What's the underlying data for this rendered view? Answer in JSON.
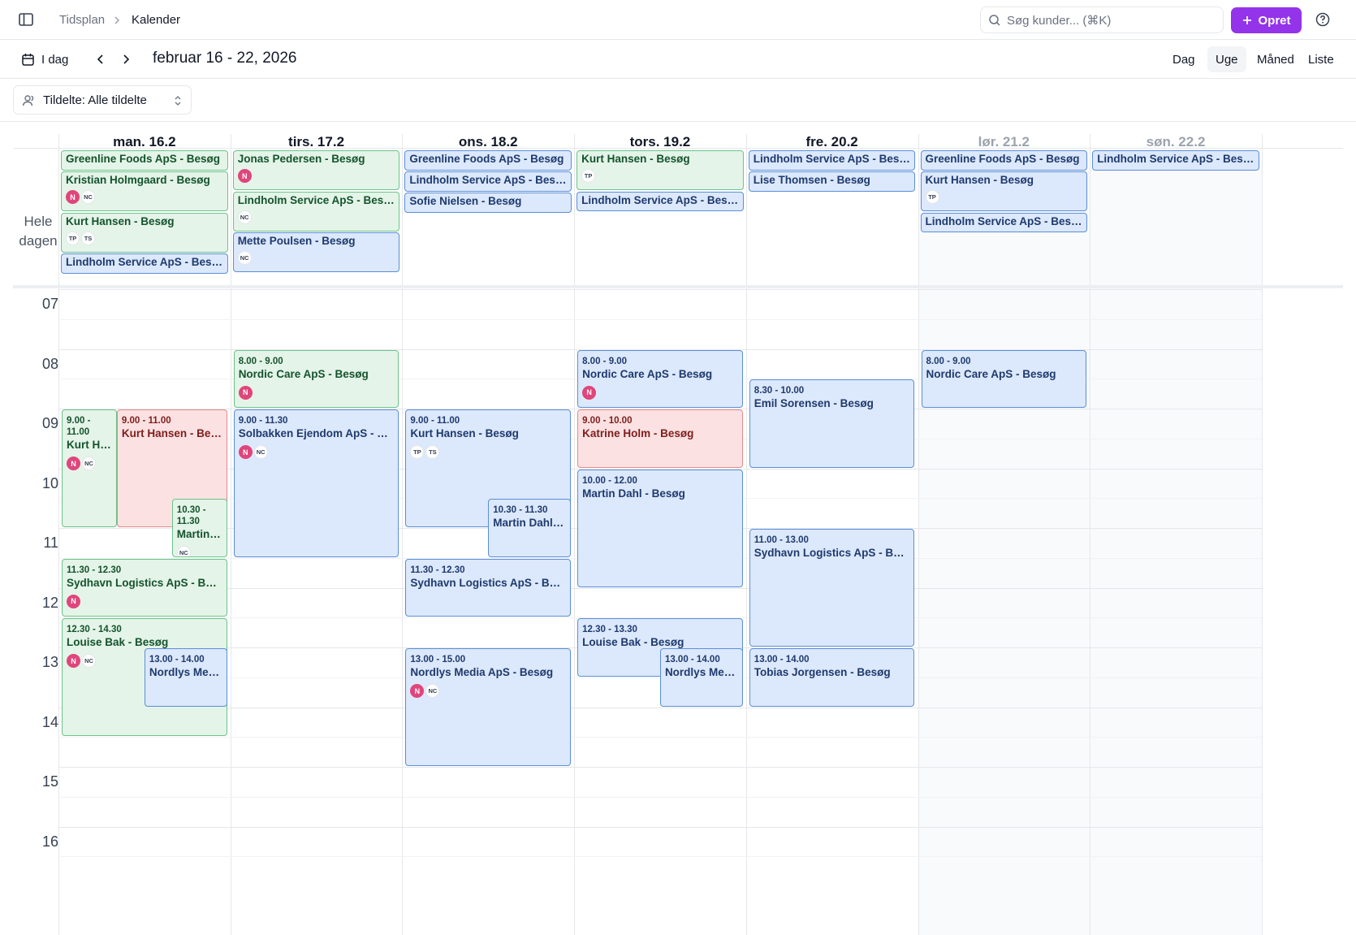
{
  "header": {
    "breadcrumb": [
      "Tidsplan",
      "Kalender"
    ],
    "search_placeholder": "Søg kunder... (⌘K)",
    "create_label": "Opret"
  },
  "toolbar": {
    "today_label": "I dag",
    "range_title": "februar 16 - 22, 2026",
    "views": [
      "Dag",
      "Uge",
      "Måned",
      "Liste"
    ],
    "active_view": "Uge"
  },
  "filter": {
    "assignee_label": "Tildelte: Alle tildelte"
  },
  "calendar": {
    "allday_label": [
      "Hele",
      "dagen"
    ],
    "hours": [
      "07",
      "08",
      "09",
      "10",
      "11",
      "12",
      "13",
      "14",
      "15",
      "16"
    ],
    "days": [
      {
        "label": "man. 16.2",
        "weekend": false
      },
      {
        "label": "tirs. 17.2",
        "weekend": false
      },
      {
        "label": "ons. 18.2",
        "weekend": false
      },
      {
        "label": "tors. 19.2",
        "weekend": false
      },
      {
        "label": "fre. 20.2",
        "weekend": false
      },
      {
        "label": "lør. 21.2",
        "weekend": true
      },
      {
        "label": "søn. 22.2",
        "weekend": true
      }
    ],
    "colors": {
      "green": "#e4f4e8",
      "blue": "#dce8fb",
      "red": "#fbe1e1",
      "accent": "#9333ea",
      "avatar": "#e0457b"
    },
    "allday_events": [
      {
        "day": 0,
        "title": "Greenline Foods ApS - Besøg",
        "color": "green",
        "avatars": []
      },
      {
        "day": 0,
        "title": "Kristian Holmgaard - Besøg",
        "color": "green",
        "avatars": [
          "N",
          "NC"
        ]
      },
      {
        "day": 0,
        "title": "Kurt Hansen - Besøg",
        "color": "green",
        "avatars": [
          "TP",
          "TS"
        ]
      },
      {
        "day": 0,
        "title": "Lindholm Service ApS - Besøg",
        "color": "blue",
        "avatars": []
      },
      {
        "day": 1,
        "title": "Jonas Pedersen - Besøg",
        "color": "green",
        "avatars": [
          "N"
        ]
      },
      {
        "day": 1,
        "title": "Lindholm Service ApS - Besøg",
        "color": "green",
        "avatars": [
          "NC"
        ]
      },
      {
        "day": 1,
        "title": "Mette Poulsen - Besøg",
        "color": "blue",
        "avatars": [
          "NC"
        ]
      },
      {
        "day": 2,
        "title": "Greenline Foods ApS - Besøg",
        "color": "blue",
        "avatars": []
      },
      {
        "day": 2,
        "title": "Lindholm Service ApS - Besøg",
        "color": "blue",
        "avatars": []
      },
      {
        "day": 2,
        "title": "Sofie Nielsen - Besøg",
        "color": "blue",
        "avatars": []
      },
      {
        "day": 3,
        "title": "Kurt Hansen - Besøg",
        "color": "green",
        "avatars": [
          "TP"
        ]
      },
      {
        "day": 3,
        "title": "Lindholm Service ApS - Besøg",
        "color": "blue",
        "avatars": []
      },
      {
        "day": 4,
        "title": "Lindholm Service ApS - Besøg",
        "color": "blue",
        "avatars": []
      },
      {
        "day": 4,
        "title": "Lise Thomsen - Besøg",
        "color": "blue",
        "avatars": []
      },
      {
        "day": 5,
        "title": "Greenline Foods ApS - Besøg",
        "color": "blue",
        "avatars": []
      },
      {
        "day": 5,
        "title": "Kurt Hansen - Besøg",
        "color": "blue",
        "avatars": [
          "TP"
        ]
      },
      {
        "day": 5,
        "title": "Lindholm Service ApS - Besøg",
        "color": "blue",
        "avatars": []
      },
      {
        "day": 6,
        "title": "Lindholm Service ApS - Besøg",
        "color": "blue",
        "avatars": []
      }
    ],
    "timed_events": [
      {
        "day": 0,
        "start": 9.0,
        "end": 11.0,
        "time": "9.00 - 11.00",
        "title": "Kurt Hansen - Besøg",
        "color": "green",
        "avatars": [
          "N",
          "NC"
        ],
        "col": 0,
        "cols": 3
      },
      {
        "day": 0,
        "start": 9.0,
        "end": 11.0,
        "time": "9.00 - 11.00",
        "title": "Kurt Hansen - Besøg",
        "color": "red",
        "avatars": [],
        "col": 1,
        "cols": 3,
        "span": 2
      },
      {
        "day": 0,
        "start": 10.5,
        "end": 11.5,
        "time": "10.30 - 11.30",
        "title": "Martin Dahl - Besøg",
        "color": "green",
        "avatars": [
          "NC"
        ],
        "col": 2,
        "cols": 3
      },
      {
        "day": 0,
        "start": 11.5,
        "end": 12.5,
        "time": "11.30 - 12.30",
        "title": "Sydhavn Logistics ApS - Besøg",
        "color": "green",
        "avatars": [
          "N"
        ],
        "col": 0,
        "cols": 1
      },
      {
        "day": 0,
        "start": 12.5,
        "end": 14.5,
        "time": "12.30 - 14.30",
        "title": "Louise Bak - Besøg",
        "color": "green",
        "avatars": [
          "N",
          "NC"
        ],
        "col": 0,
        "cols": 1
      },
      {
        "day": 0,
        "start": 13.0,
        "end": 14.0,
        "time": "13.00 - 14.00",
        "title": "Nordlys Media ApS - Besøg",
        "color": "blue",
        "avatars": [],
        "col": 1,
        "cols": 2
      },
      {
        "day": 1,
        "start": 8.0,
        "end": 9.0,
        "time": "8.00 - 9.00",
        "title": "Nordic Care ApS - Besøg",
        "color": "green",
        "avatars": [
          "N"
        ],
        "col": 0,
        "cols": 1
      },
      {
        "day": 1,
        "start": 9.0,
        "end": 11.5,
        "time": "9.00 - 11.30",
        "title": "Solbakken Ejendom ApS - Besøg",
        "color": "blue",
        "avatars": [
          "N",
          "NC"
        ],
        "col": 0,
        "cols": 1
      },
      {
        "day": 2,
        "start": 9.0,
        "end": 11.0,
        "time": "9.00 - 11.00",
        "title": "Kurt Hansen - Besøg",
        "color": "blue",
        "avatars": [
          "TP",
          "TS"
        ],
        "col": 0,
        "cols": 1
      },
      {
        "day": 2,
        "start": 10.5,
        "end": 11.5,
        "time": "10.30 - 11.30",
        "title": "Martin Dahl - Besøg",
        "color": "blue",
        "avatars": [],
        "col": 1,
        "cols": 2
      },
      {
        "day": 2,
        "start": 11.5,
        "end": 12.5,
        "time": "11.30 - 12.30",
        "title": "Sydhavn Logistics ApS - Besøg",
        "color": "blue",
        "avatars": [],
        "col": 0,
        "cols": 1
      },
      {
        "day": 2,
        "start": 13.0,
        "end": 15.0,
        "time": "13.00 - 15.00",
        "title": "Nordlys Media ApS - Besøg",
        "color": "blue",
        "avatars": [
          "N",
          "NC"
        ],
        "col": 0,
        "cols": 1
      },
      {
        "day": 3,
        "start": 8.0,
        "end": 9.0,
        "time": "8.00 - 9.00",
        "title": "Nordic Care ApS - Besøg",
        "color": "blue",
        "avatars": [
          "N"
        ],
        "col": 0,
        "cols": 1
      },
      {
        "day": 3,
        "start": 9.0,
        "end": 10.0,
        "time": "9.00 - 10.00",
        "title": "Katrine Holm - Besøg",
        "color": "red",
        "avatars": [],
        "col": 0,
        "cols": 1
      },
      {
        "day": 3,
        "start": 10.0,
        "end": 12.0,
        "time": "10.00 - 12.00",
        "title": "Martin Dahl - Besøg",
        "color": "blue",
        "avatars": [],
        "col": 0,
        "cols": 1
      },
      {
        "day": 3,
        "start": 12.5,
        "end": 13.5,
        "time": "12.30 - 13.30",
        "title": "Louise Bak - Besøg",
        "color": "blue",
        "avatars": [],
        "col": 0,
        "cols": 1
      },
      {
        "day": 3,
        "start": 13.0,
        "end": 14.0,
        "time": "13.00 - 14.00",
        "title": "Nordlys Media ApS - Besøg",
        "color": "blue",
        "avatars": [],
        "col": 1,
        "cols": 2
      },
      {
        "day": 4,
        "start": 8.5,
        "end": 10.0,
        "time": "8.30 - 10.00",
        "title": "Emil Sorensen - Besøg",
        "color": "blue",
        "avatars": [],
        "col": 0,
        "cols": 1
      },
      {
        "day": 4,
        "start": 11.0,
        "end": 13.0,
        "time": "11.00 - 13.00",
        "title": "Sydhavn Logistics ApS - Besøg",
        "color": "blue",
        "avatars": [],
        "col": 0,
        "cols": 1
      },
      {
        "day": 4,
        "start": 13.0,
        "end": 14.0,
        "time": "13.00 - 14.00",
        "title": "Tobias Jorgensen - Besøg",
        "color": "blue",
        "avatars": [],
        "col": 0,
        "cols": 1
      },
      {
        "day": 5,
        "start": 8.0,
        "end": 9.0,
        "time": "8.00 - 9.00",
        "title": "Nordic Care ApS - Besøg",
        "color": "blue",
        "avatars": [],
        "col": 0,
        "cols": 1
      }
    ]
  }
}
